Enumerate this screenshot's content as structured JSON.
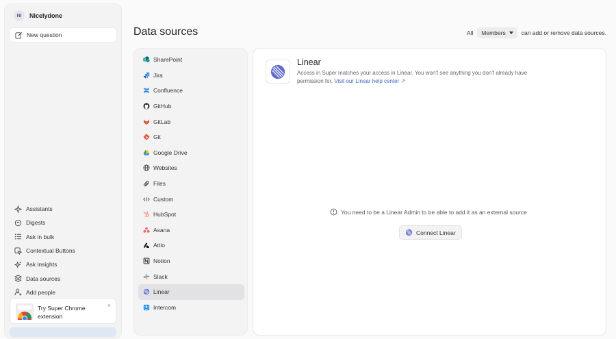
{
  "workspace": {
    "initials": "NI",
    "name": "Nicelydone"
  },
  "sidebar": {
    "new_question": "New question",
    "nav": [
      {
        "label": "Assistants",
        "icon": "sparkle-icon"
      },
      {
        "label": "Digests",
        "icon": "digest-icon"
      },
      {
        "label": "Ask in bulk",
        "icon": "list-icon"
      },
      {
        "label": "Contextual Buttons",
        "icon": "cursor-button-icon"
      },
      {
        "label": "Ask insights",
        "icon": "insights-sparkle-icon"
      },
      {
        "label": "Data sources",
        "icon": "layers-icon"
      },
      {
        "label": "Add people",
        "icon": "add-user-icon"
      }
    ],
    "promo": {
      "text": "Try Super Chrome extension",
      "close": "×"
    }
  },
  "header": {
    "title": "Data sources",
    "perm_prefix": "All",
    "perm_select": "Members",
    "perm_suffix": "can add or remove data sources."
  },
  "sources": [
    {
      "label": "SharePoint",
      "icon": "sharepoint-icon",
      "color": "#0f7b84"
    },
    {
      "label": "Jira",
      "icon": "jira-icon",
      "color": "#2684ff"
    },
    {
      "label": "Confluence",
      "icon": "confluence-icon",
      "color": "#1d7afc"
    },
    {
      "label": "GitHub",
      "icon": "github-icon",
      "color": "#1b1f23"
    },
    {
      "label": "GitLab",
      "icon": "gitlab-icon",
      "color": "#e24329"
    },
    {
      "label": "Git",
      "icon": "git-icon",
      "color": "#f05133"
    },
    {
      "label": "Google Drive",
      "icon": "google-drive-icon",
      "color": "#1fa463"
    },
    {
      "label": "Websites",
      "icon": "globe-icon",
      "color": "#333333"
    },
    {
      "label": "Files",
      "icon": "paperclip-icon",
      "color": "#333333"
    },
    {
      "label": "Custom",
      "icon": "code-icon",
      "color": "#333333"
    },
    {
      "label": "HubSpot",
      "icon": "hubspot-icon",
      "color": "#ff7a59"
    },
    {
      "label": "Asana",
      "icon": "asana-icon",
      "color": "#f06a6a"
    },
    {
      "label": "Attio",
      "icon": "attio-icon",
      "color": "#111111"
    },
    {
      "label": "Notion",
      "icon": "notion-icon",
      "color": "#111111"
    },
    {
      "label": "Slack",
      "icon": "slack-icon",
      "color": "#e01e5a"
    },
    {
      "label": "Linear",
      "icon": "linear-icon",
      "color": "#5e6ad2",
      "active": true
    },
    {
      "label": "Intercom",
      "icon": "intercom-icon",
      "color": "#1f8ded"
    }
  ],
  "detail": {
    "title": "Linear",
    "description": "Access in Super matches your access in Linear. You won't see anything you don't already have permission for.",
    "link": "Visit our Linear help center ↗",
    "notice": "You need to be a Linear Admin to be able to add it as an external source",
    "connect_label": "Connect Linear"
  },
  "colors": {
    "accent": "#3d69c6",
    "linear": "#5e6ad2",
    "panel_bg": "#f3f3f4"
  }
}
